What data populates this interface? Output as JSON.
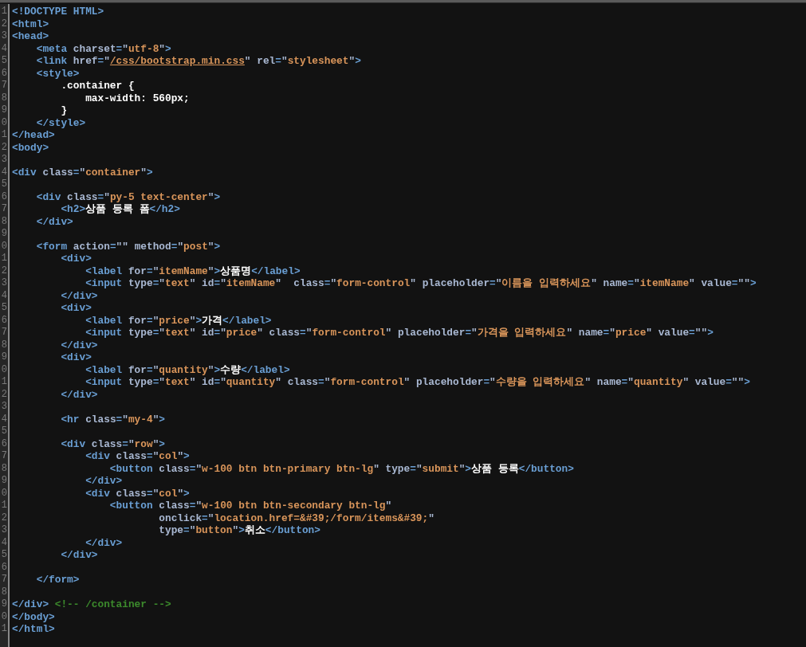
{
  "editor": {
    "lines": [
      {
        "number": "1",
        "segments": [
          {
            "kind": "tag",
            "text": "<!DOCTYPE HTML>"
          }
        ]
      },
      {
        "number": "2",
        "segments": [
          {
            "kind": "tag",
            "text": "<html>"
          }
        ]
      },
      {
        "number": "3",
        "segments": [
          {
            "kind": "tag",
            "text": "<head>"
          }
        ]
      },
      {
        "number": "4",
        "segments": [
          {
            "kind": "tag",
            "text": "    <meta"
          },
          {
            "kind": "attr",
            "text": " charset"
          },
          {
            "kind": "tag",
            "text": "="
          },
          {
            "kind": "string",
            "text": "\"utf-8\""
          },
          {
            "kind": "tag",
            "text": ">"
          }
        ]
      },
      {
        "number": "5",
        "segments": [
          {
            "kind": "tag",
            "text": "    <link"
          },
          {
            "kind": "attr",
            "text": " href"
          },
          {
            "kind": "tag",
            "text": "="
          },
          {
            "kind": "link",
            "text": "\"/css/bootstrap.min.css\""
          },
          {
            "kind": "attr",
            "text": " rel"
          },
          {
            "kind": "tag",
            "text": "="
          },
          {
            "kind": "string",
            "text": "\"stylesheet\""
          },
          {
            "kind": "tag",
            "text": ">"
          }
        ]
      },
      {
        "number": "6",
        "segments": [
          {
            "kind": "tag",
            "text": "    <style>"
          }
        ]
      },
      {
        "number": "7",
        "segments": [
          {
            "kind": "text",
            "text": "        .container {"
          }
        ]
      },
      {
        "number": "8",
        "segments": [
          {
            "kind": "text",
            "text": "            max-width: 560px;"
          }
        ]
      },
      {
        "number": "9",
        "segments": [
          {
            "kind": "text",
            "text": "        }"
          }
        ]
      },
      {
        "number": "0",
        "segments": [
          {
            "kind": "tag",
            "text": "    </style>"
          }
        ]
      },
      {
        "number": "1",
        "segments": [
          {
            "kind": "tag",
            "text": "</head>"
          }
        ]
      },
      {
        "number": "2",
        "segments": [
          {
            "kind": "tag",
            "text": "<body>"
          }
        ]
      },
      {
        "number": "3"
      },
      {
        "number": "4",
        "segments": [
          {
            "kind": "tag",
            "text": "<div"
          },
          {
            "kind": "attr",
            "text": " class"
          },
          {
            "kind": "tag",
            "text": "="
          },
          {
            "kind": "string",
            "text": "\"container\""
          },
          {
            "kind": "tag",
            "text": ">"
          }
        ]
      },
      {
        "number": "5"
      },
      {
        "number": "6",
        "segments": [
          {
            "kind": "tag",
            "text": "    <div"
          },
          {
            "kind": "attr",
            "text": " class"
          },
          {
            "kind": "tag",
            "text": "="
          },
          {
            "kind": "string",
            "text": "\"py-5 text-center\""
          },
          {
            "kind": "tag",
            "text": ">"
          }
        ]
      },
      {
        "number": "7",
        "segments": [
          {
            "kind": "tag",
            "text": "        <h2>"
          },
          {
            "kind": "text",
            "text": "상품 등록 폼"
          },
          {
            "kind": "tag",
            "text": "</h2>"
          }
        ]
      },
      {
        "number": "8",
        "segments": [
          {
            "kind": "tag",
            "text": "    </div>"
          }
        ]
      },
      {
        "number": "9"
      },
      {
        "number": "0",
        "segments": [
          {
            "kind": "tag",
            "text": "    <form"
          },
          {
            "kind": "attr",
            "text": " action"
          },
          {
            "kind": "tag",
            "text": "="
          },
          {
            "kind": "string",
            "text": "\"\""
          },
          {
            "kind": "attr",
            "text": " method"
          },
          {
            "kind": "tag",
            "text": "="
          },
          {
            "kind": "string",
            "text": "\"post\""
          },
          {
            "kind": "tag",
            "text": ">"
          }
        ]
      },
      {
        "number": "1",
        "segments": [
          {
            "kind": "tag",
            "text": "        <div>"
          }
        ]
      },
      {
        "number": "2",
        "segments": [
          {
            "kind": "tag",
            "text": "            <label"
          },
          {
            "kind": "attr",
            "text": " for"
          },
          {
            "kind": "tag",
            "text": "="
          },
          {
            "kind": "string",
            "text": "\"itemName\""
          },
          {
            "kind": "tag",
            "text": ">"
          },
          {
            "kind": "text",
            "text": "상품명"
          },
          {
            "kind": "tag",
            "text": "</label>"
          }
        ]
      },
      {
        "number": "3",
        "segments": [
          {
            "kind": "tag",
            "text": "            <input"
          },
          {
            "kind": "attr",
            "text": " type"
          },
          {
            "kind": "tag",
            "text": "="
          },
          {
            "kind": "string",
            "text": "\"text\""
          },
          {
            "kind": "attr",
            "text": " id"
          },
          {
            "kind": "tag",
            "text": "="
          },
          {
            "kind": "string",
            "text": "\"itemName\""
          },
          {
            "kind": "attr",
            "text": "  class"
          },
          {
            "kind": "tag",
            "text": "="
          },
          {
            "kind": "string",
            "text": "\"form-control\""
          },
          {
            "kind": "attr",
            "text": " placeholder"
          },
          {
            "kind": "tag",
            "text": "="
          },
          {
            "kind": "string",
            "text": "\"이름을 입력하세요\""
          },
          {
            "kind": "attr",
            "text": " name"
          },
          {
            "kind": "tag",
            "text": "="
          },
          {
            "kind": "string",
            "text": "\"itemName\""
          },
          {
            "kind": "attr",
            "text": " value"
          },
          {
            "kind": "tag",
            "text": "="
          },
          {
            "kind": "string",
            "text": "\"\""
          },
          {
            "kind": "tag",
            "text": ">"
          }
        ]
      },
      {
        "number": "4",
        "segments": [
          {
            "kind": "tag",
            "text": "        </div>"
          }
        ]
      },
      {
        "number": "5",
        "segments": [
          {
            "kind": "tag",
            "text": "        <div>"
          }
        ]
      },
      {
        "number": "6",
        "segments": [
          {
            "kind": "tag",
            "text": "            <label"
          },
          {
            "kind": "attr",
            "text": " for"
          },
          {
            "kind": "tag",
            "text": "="
          },
          {
            "kind": "string",
            "text": "\"price\""
          },
          {
            "kind": "tag",
            "text": ">"
          },
          {
            "kind": "text",
            "text": "가격"
          },
          {
            "kind": "tag",
            "text": "</label>"
          }
        ]
      },
      {
        "number": "7",
        "segments": [
          {
            "kind": "tag",
            "text": "            <input"
          },
          {
            "kind": "attr",
            "text": " type"
          },
          {
            "kind": "tag",
            "text": "="
          },
          {
            "kind": "string",
            "text": "\"text\""
          },
          {
            "kind": "attr",
            "text": " id"
          },
          {
            "kind": "tag",
            "text": "="
          },
          {
            "kind": "string",
            "text": "\"price\""
          },
          {
            "kind": "attr",
            "text": " class"
          },
          {
            "kind": "tag",
            "text": "="
          },
          {
            "kind": "string",
            "text": "\"form-control\""
          },
          {
            "kind": "attr",
            "text": " placeholder"
          },
          {
            "kind": "tag",
            "text": "="
          },
          {
            "kind": "string",
            "text": "\"가격을 입력하세요\""
          },
          {
            "kind": "attr",
            "text": " name"
          },
          {
            "kind": "tag",
            "text": "="
          },
          {
            "kind": "string",
            "text": "\"price\""
          },
          {
            "kind": "attr",
            "text": " value"
          },
          {
            "kind": "tag",
            "text": "="
          },
          {
            "kind": "string",
            "text": "\"\""
          },
          {
            "kind": "tag",
            "text": ">"
          }
        ]
      },
      {
        "number": "8",
        "segments": [
          {
            "kind": "tag",
            "text": "        </div>"
          }
        ]
      },
      {
        "number": "9",
        "segments": [
          {
            "kind": "tag",
            "text": "        <div>"
          }
        ]
      },
      {
        "number": "0",
        "segments": [
          {
            "kind": "tag",
            "text": "            <label"
          },
          {
            "kind": "attr",
            "text": " for"
          },
          {
            "kind": "tag",
            "text": "="
          },
          {
            "kind": "string",
            "text": "\"quantity\""
          },
          {
            "kind": "tag",
            "text": ">"
          },
          {
            "kind": "text",
            "text": "수량"
          },
          {
            "kind": "tag",
            "text": "</label>"
          }
        ]
      },
      {
        "number": "1",
        "segments": [
          {
            "kind": "tag",
            "text": "            <input"
          },
          {
            "kind": "attr",
            "text": " type"
          },
          {
            "kind": "tag",
            "text": "="
          },
          {
            "kind": "string",
            "text": "\"text\""
          },
          {
            "kind": "attr",
            "text": " id"
          },
          {
            "kind": "tag",
            "text": "="
          },
          {
            "kind": "string",
            "text": "\"quantity\""
          },
          {
            "kind": "attr",
            "text": " class"
          },
          {
            "kind": "tag",
            "text": "="
          },
          {
            "kind": "string",
            "text": "\"form-control\""
          },
          {
            "kind": "attr",
            "text": " placeholder"
          },
          {
            "kind": "tag",
            "text": "="
          },
          {
            "kind": "string",
            "text": "\"수량을 입력하세요\""
          },
          {
            "kind": "attr",
            "text": " name"
          },
          {
            "kind": "tag",
            "text": "="
          },
          {
            "kind": "string",
            "text": "\"quantity\""
          },
          {
            "kind": "attr",
            "text": " value"
          },
          {
            "kind": "tag",
            "text": "="
          },
          {
            "kind": "string",
            "text": "\"\""
          },
          {
            "kind": "tag",
            "text": ">"
          }
        ]
      },
      {
        "number": "2",
        "segments": [
          {
            "kind": "tag",
            "text": "        </div>"
          }
        ]
      },
      {
        "number": "3"
      },
      {
        "number": "4",
        "segments": [
          {
            "kind": "tag",
            "text": "        <hr"
          },
          {
            "kind": "attr",
            "text": " class"
          },
          {
            "kind": "tag",
            "text": "="
          },
          {
            "kind": "string",
            "text": "\"my-4\""
          },
          {
            "kind": "tag",
            "text": ">"
          }
        ]
      },
      {
        "number": "5"
      },
      {
        "number": "6",
        "segments": [
          {
            "kind": "tag",
            "text": "        <div"
          },
          {
            "kind": "attr",
            "text": " class"
          },
          {
            "kind": "tag",
            "text": "="
          },
          {
            "kind": "string",
            "text": "\"row\""
          },
          {
            "kind": "tag",
            "text": ">"
          }
        ]
      },
      {
        "number": "7",
        "segments": [
          {
            "kind": "tag",
            "text": "            <div"
          },
          {
            "kind": "attr",
            "text": " class"
          },
          {
            "kind": "tag",
            "text": "="
          },
          {
            "kind": "string",
            "text": "\"col\""
          },
          {
            "kind": "tag",
            "text": ">"
          }
        ]
      },
      {
        "number": "8",
        "segments": [
          {
            "kind": "tag",
            "text": "                <button"
          },
          {
            "kind": "attr",
            "text": " class"
          },
          {
            "kind": "tag",
            "text": "="
          },
          {
            "kind": "string",
            "text": "\"w-100 btn btn-primary btn-lg\""
          },
          {
            "kind": "attr",
            "text": " type"
          },
          {
            "kind": "tag",
            "text": "="
          },
          {
            "kind": "string",
            "text": "\"submit\""
          },
          {
            "kind": "tag",
            "text": ">"
          },
          {
            "kind": "text",
            "text": "상품 등록"
          },
          {
            "kind": "tag",
            "text": "</button>"
          }
        ]
      },
      {
        "number": "9",
        "segments": [
          {
            "kind": "tag",
            "text": "            </div>"
          }
        ]
      },
      {
        "number": "0",
        "segments": [
          {
            "kind": "tag",
            "text": "            <div"
          },
          {
            "kind": "attr",
            "text": " class"
          },
          {
            "kind": "tag",
            "text": "="
          },
          {
            "kind": "string",
            "text": "\"col\""
          },
          {
            "kind": "tag",
            "text": ">"
          }
        ]
      },
      {
        "number": "1",
        "segments": [
          {
            "kind": "tag",
            "text": "                <button"
          },
          {
            "kind": "attr",
            "text": " class"
          },
          {
            "kind": "tag",
            "text": "="
          },
          {
            "kind": "string",
            "text": "\"w-100 btn btn-secondary btn-lg\""
          }
        ]
      },
      {
        "number": "2",
        "segments": [
          {
            "kind": "attr",
            "text": "                        onclick"
          },
          {
            "kind": "tag",
            "text": "="
          },
          {
            "kind": "string",
            "text": "\"location.href=&#39;/form/items&#39;\""
          }
        ]
      },
      {
        "number": "3",
        "segments": [
          {
            "kind": "attr",
            "text": "                        type"
          },
          {
            "kind": "tag",
            "text": "="
          },
          {
            "kind": "string",
            "text": "\"button\""
          },
          {
            "kind": "tag",
            "text": ">"
          },
          {
            "kind": "text",
            "text": "취소"
          },
          {
            "kind": "tag",
            "text": "</button>"
          }
        ]
      },
      {
        "number": "4",
        "segments": [
          {
            "kind": "tag",
            "text": "            </div>"
          }
        ]
      },
      {
        "number": "5",
        "segments": [
          {
            "kind": "tag",
            "text": "        </div>"
          }
        ]
      },
      {
        "number": "6"
      },
      {
        "number": "7",
        "segments": [
          {
            "kind": "tag",
            "text": "    </form>"
          }
        ]
      },
      {
        "number": "8"
      },
      {
        "number": "9",
        "segments": [
          {
            "kind": "tag",
            "text": "</div>"
          },
          {
            "kind": "comment",
            "text": " <!-- /container -->"
          }
        ]
      },
      {
        "number": "0",
        "segments": [
          {
            "kind": "tag",
            "text": "</body>"
          }
        ]
      },
      {
        "number": "1",
        "segments": [
          {
            "kind": "tag",
            "text": "</html>"
          }
        ]
      }
    ]
  }
}
